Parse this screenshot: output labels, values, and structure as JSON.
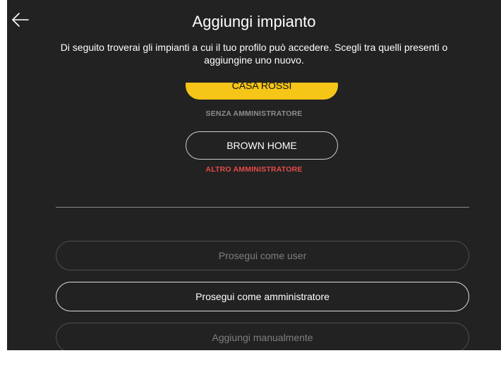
{
  "header": {
    "title": "Aggiungi impianto",
    "subtitle": "Di seguito troverai gli impianti a cui il tuo profilo può accedere. Scegli tra quelli presenti o aggiungine uno nuovo."
  },
  "icons": {
    "back": "back-arrow-icon"
  },
  "colors": {
    "background": "#222222",
    "accent": "#f5c518",
    "warning": "#e84a4a",
    "muted": "#8e8e8e"
  },
  "plants": [
    {
      "name": "CASA ROSSI",
      "status": "SENZA AMMINISTRATORE",
      "selected": true
    },
    {
      "name": "BROWN HOME",
      "status": "ALTRO AMMINISTRATORE",
      "selected": false
    }
  ],
  "actions": {
    "continue_user": "Prosegui come user",
    "continue_admin": "Prosegui come amministratore",
    "add_manual": "Aggiungi manualmente"
  }
}
